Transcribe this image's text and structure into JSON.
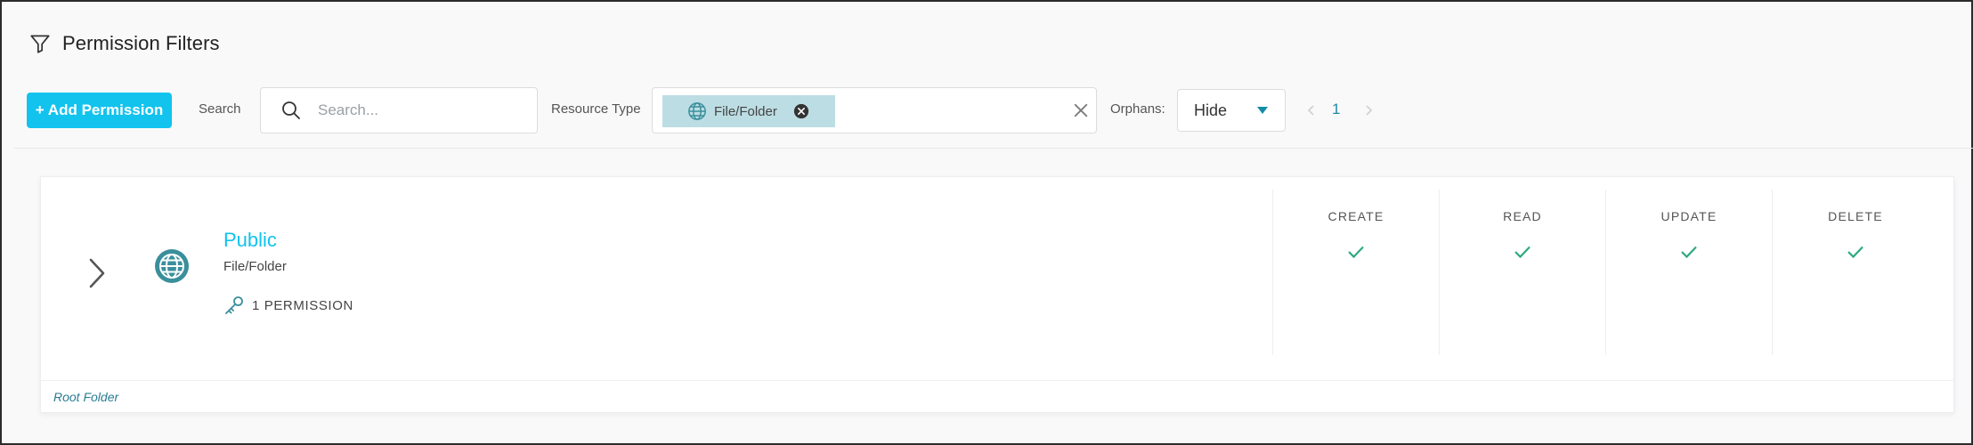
{
  "header": {
    "title": "Permission Filters",
    "icon": "filter-icon"
  },
  "toolbar": {
    "add_button_label": "+ Add Permission",
    "search_label": "Search",
    "search_placeholder": "Search...",
    "search_value": "",
    "resource_type_label": "Resource Type",
    "resource_type_chips": [
      {
        "label": "File/Folder",
        "icon": "globe-icon"
      }
    ],
    "orphans_label": "Orphans:",
    "orphans_value": "Hide",
    "pagination": {
      "current_page": "1"
    }
  },
  "colors": {
    "accent": "#12c3ee",
    "chip_bg": "#bcdde3",
    "icon_teal": "#3a8f9c",
    "check_green": "#2eaa7e",
    "footer_text": "#2a7c92"
  },
  "permissions": [
    {
      "name": "Public",
      "type": "File/Folder",
      "icon": "globe-icon",
      "permission_count": "1 PERMISSION",
      "footer": "Root Folder",
      "columns": [
        {
          "label": "CREATE",
          "granted": true
        },
        {
          "label": "READ",
          "granted": true
        },
        {
          "label": "UPDATE",
          "granted": true
        },
        {
          "label": "DELETE",
          "granted": true
        }
      ]
    }
  ]
}
